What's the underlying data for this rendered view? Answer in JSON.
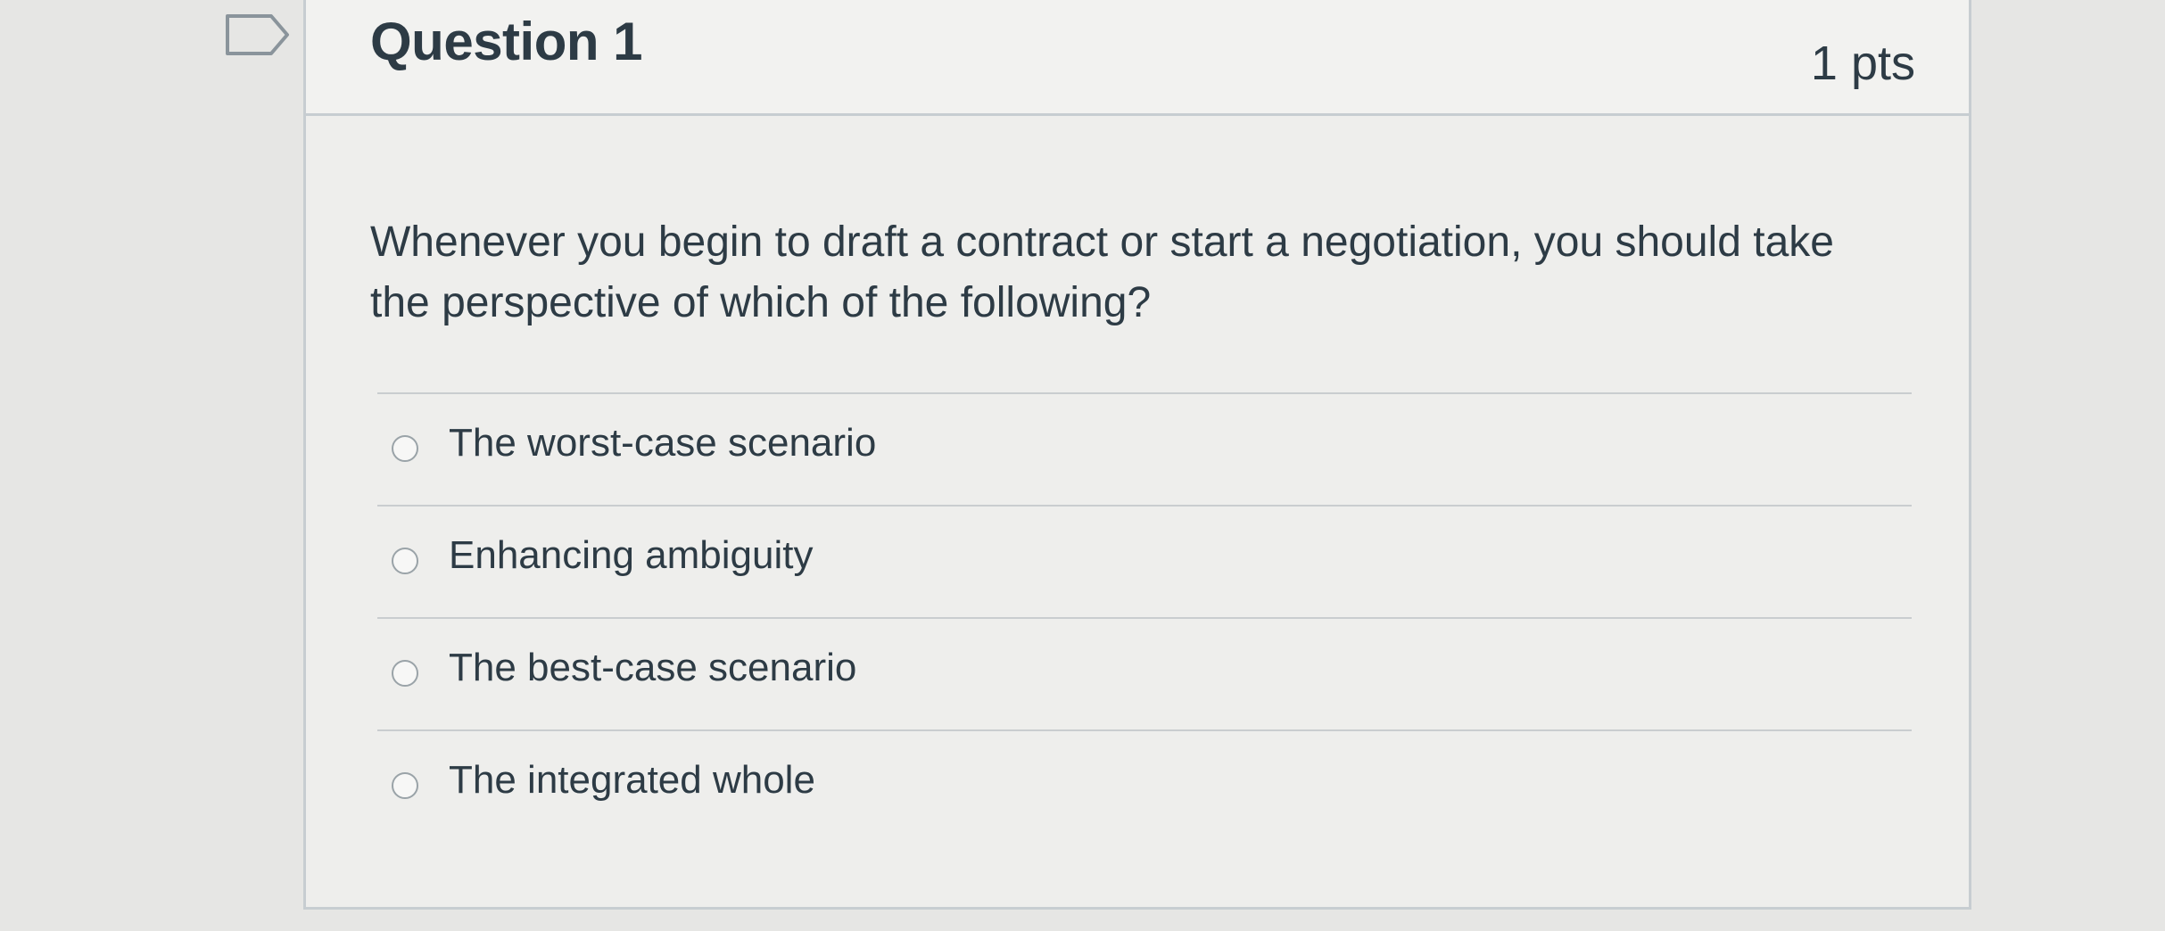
{
  "question": {
    "title": "Question 1",
    "points": "1 pts",
    "text": "Whenever you begin to draft a contract or start a negotiation, you should take the perspective of which of the following?",
    "flag_icon": "flag-outline-icon",
    "answers": [
      {
        "label": "The worst-case scenario",
        "selected": false
      },
      {
        "label": "Enhancing ambiguity",
        "selected": false
      },
      {
        "label": "The best-case scenario",
        "selected": false
      },
      {
        "label": "The integrated whole",
        "selected": false
      }
    ]
  },
  "colors": {
    "text": "#2d3b45",
    "border": "#c7cdd1",
    "background": "#e6e6e4"
  }
}
